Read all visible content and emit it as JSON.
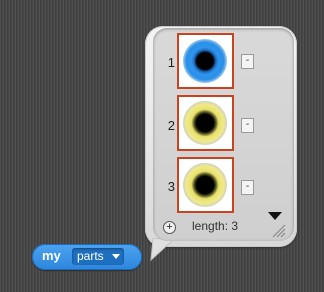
{
  "list_watcher": {
    "items": [
      {
        "index": "1",
        "ring_color": "#2a8fe6",
        "remove_label": "-"
      },
      {
        "index": "2",
        "ring_color": "#e8e06a",
        "remove_label": "-"
      },
      {
        "index": "3",
        "ring_color": "#e8e06a",
        "remove_label": "-"
      }
    ],
    "add_label": "+",
    "length_text": "length: 3"
  },
  "reporter_block": {
    "keyword": "my",
    "selected_option": "parts",
    "color": "#3a93e6"
  },
  "icons": {
    "add": "plus-circle-icon",
    "scroll": "scroll-down-arrow-icon",
    "resize": "resize-grip-icon",
    "dropdown": "dropdown-arrow-icon"
  }
}
